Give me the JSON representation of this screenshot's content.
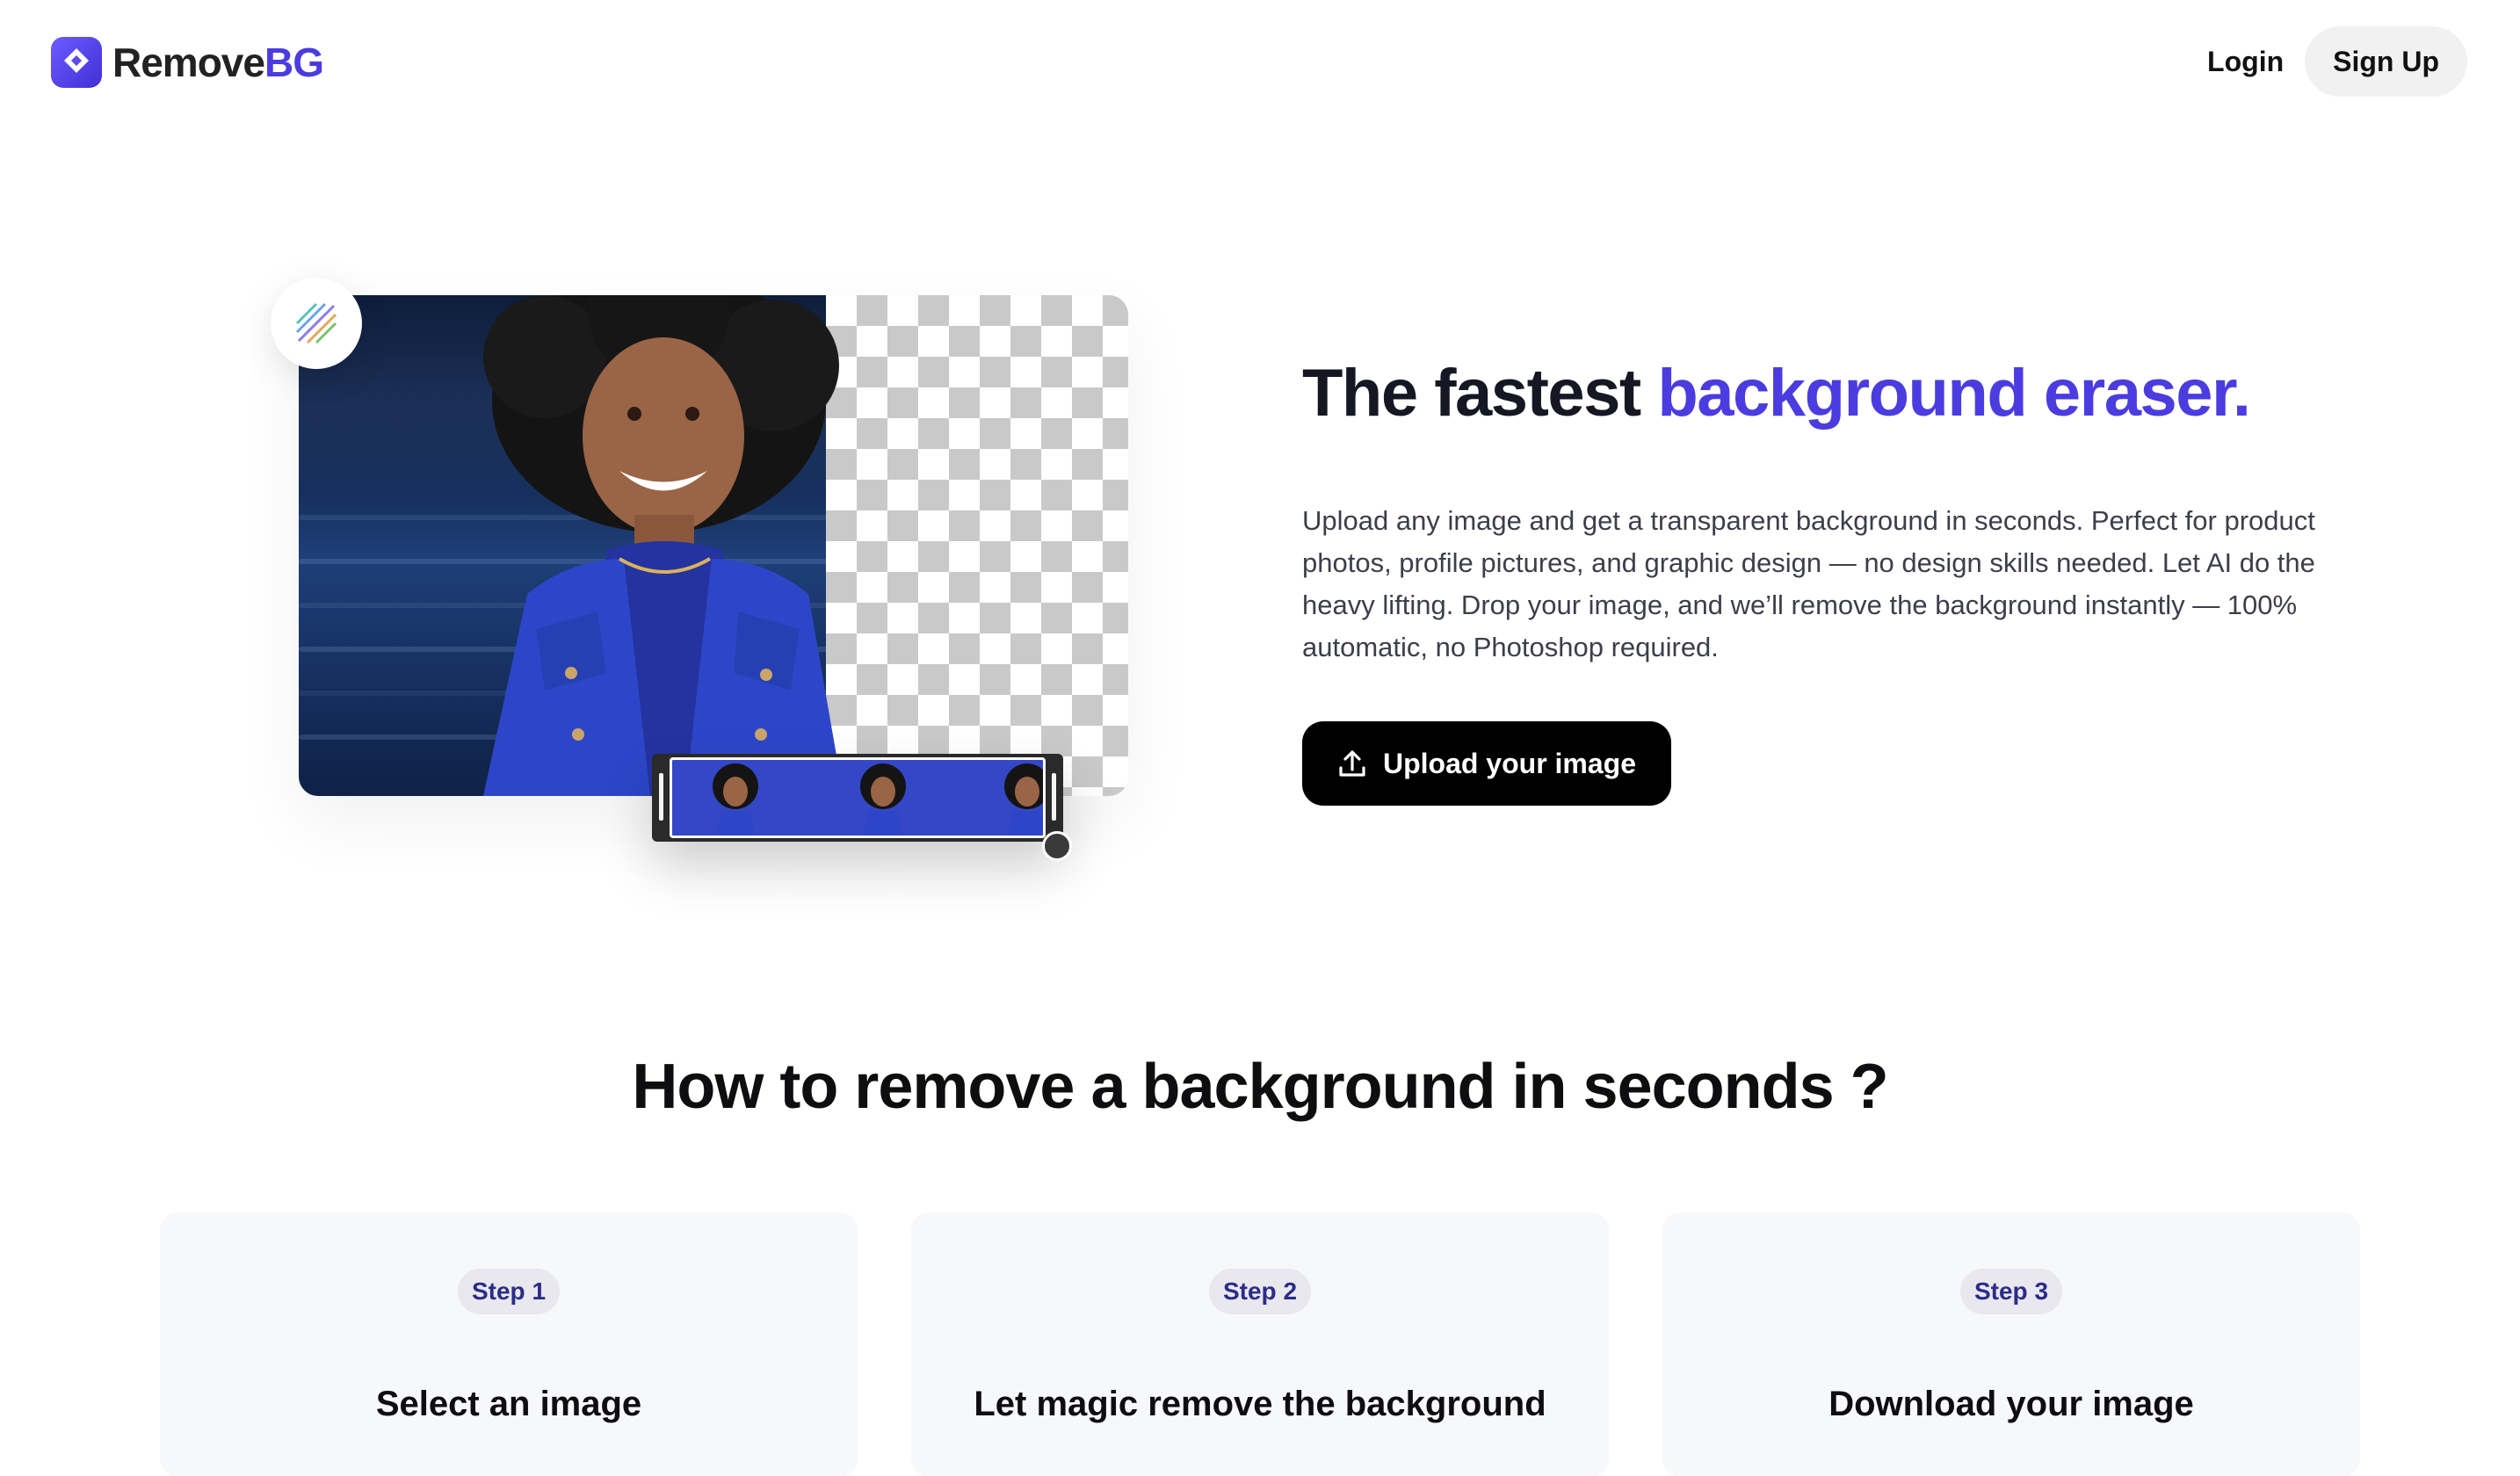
{
  "header": {
    "logo_text_main": "Remove",
    "logo_text_accent": "BG",
    "login_label": "Login",
    "signup_label": "Sign Up"
  },
  "hero": {
    "title_plain": "The fastest ",
    "title_accent": "background eraser.",
    "description": "Upload any image and get a transparent background in seconds. Perfect for product photos, profile pictures, and graphic design — no design skills needed. Let AI do the heavy lifting. Drop your image, and we’ll remove the background instantly — 100% automatic, no Photoshop required.",
    "upload_label": "Upload your image",
    "upload_icon": "upload-icon"
  },
  "howto": {
    "title": "How to remove a background in seconds ?",
    "steps": [
      {
        "pill": "Step 1",
        "title": "Select an image"
      },
      {
        "pill": "Step 2",
        "title": "Let magic remove the background"
      },
      {
        "pill": "Step 3",
        "title": "Download your image"
      }
    ]
  },
  "colors": {
    "brand_accent": "#4b3ce0",
    "button_dark": "#000000",
    "card_bg": "#f7f8fa",
    "pill_text": "#2c2c88"
  }
}
